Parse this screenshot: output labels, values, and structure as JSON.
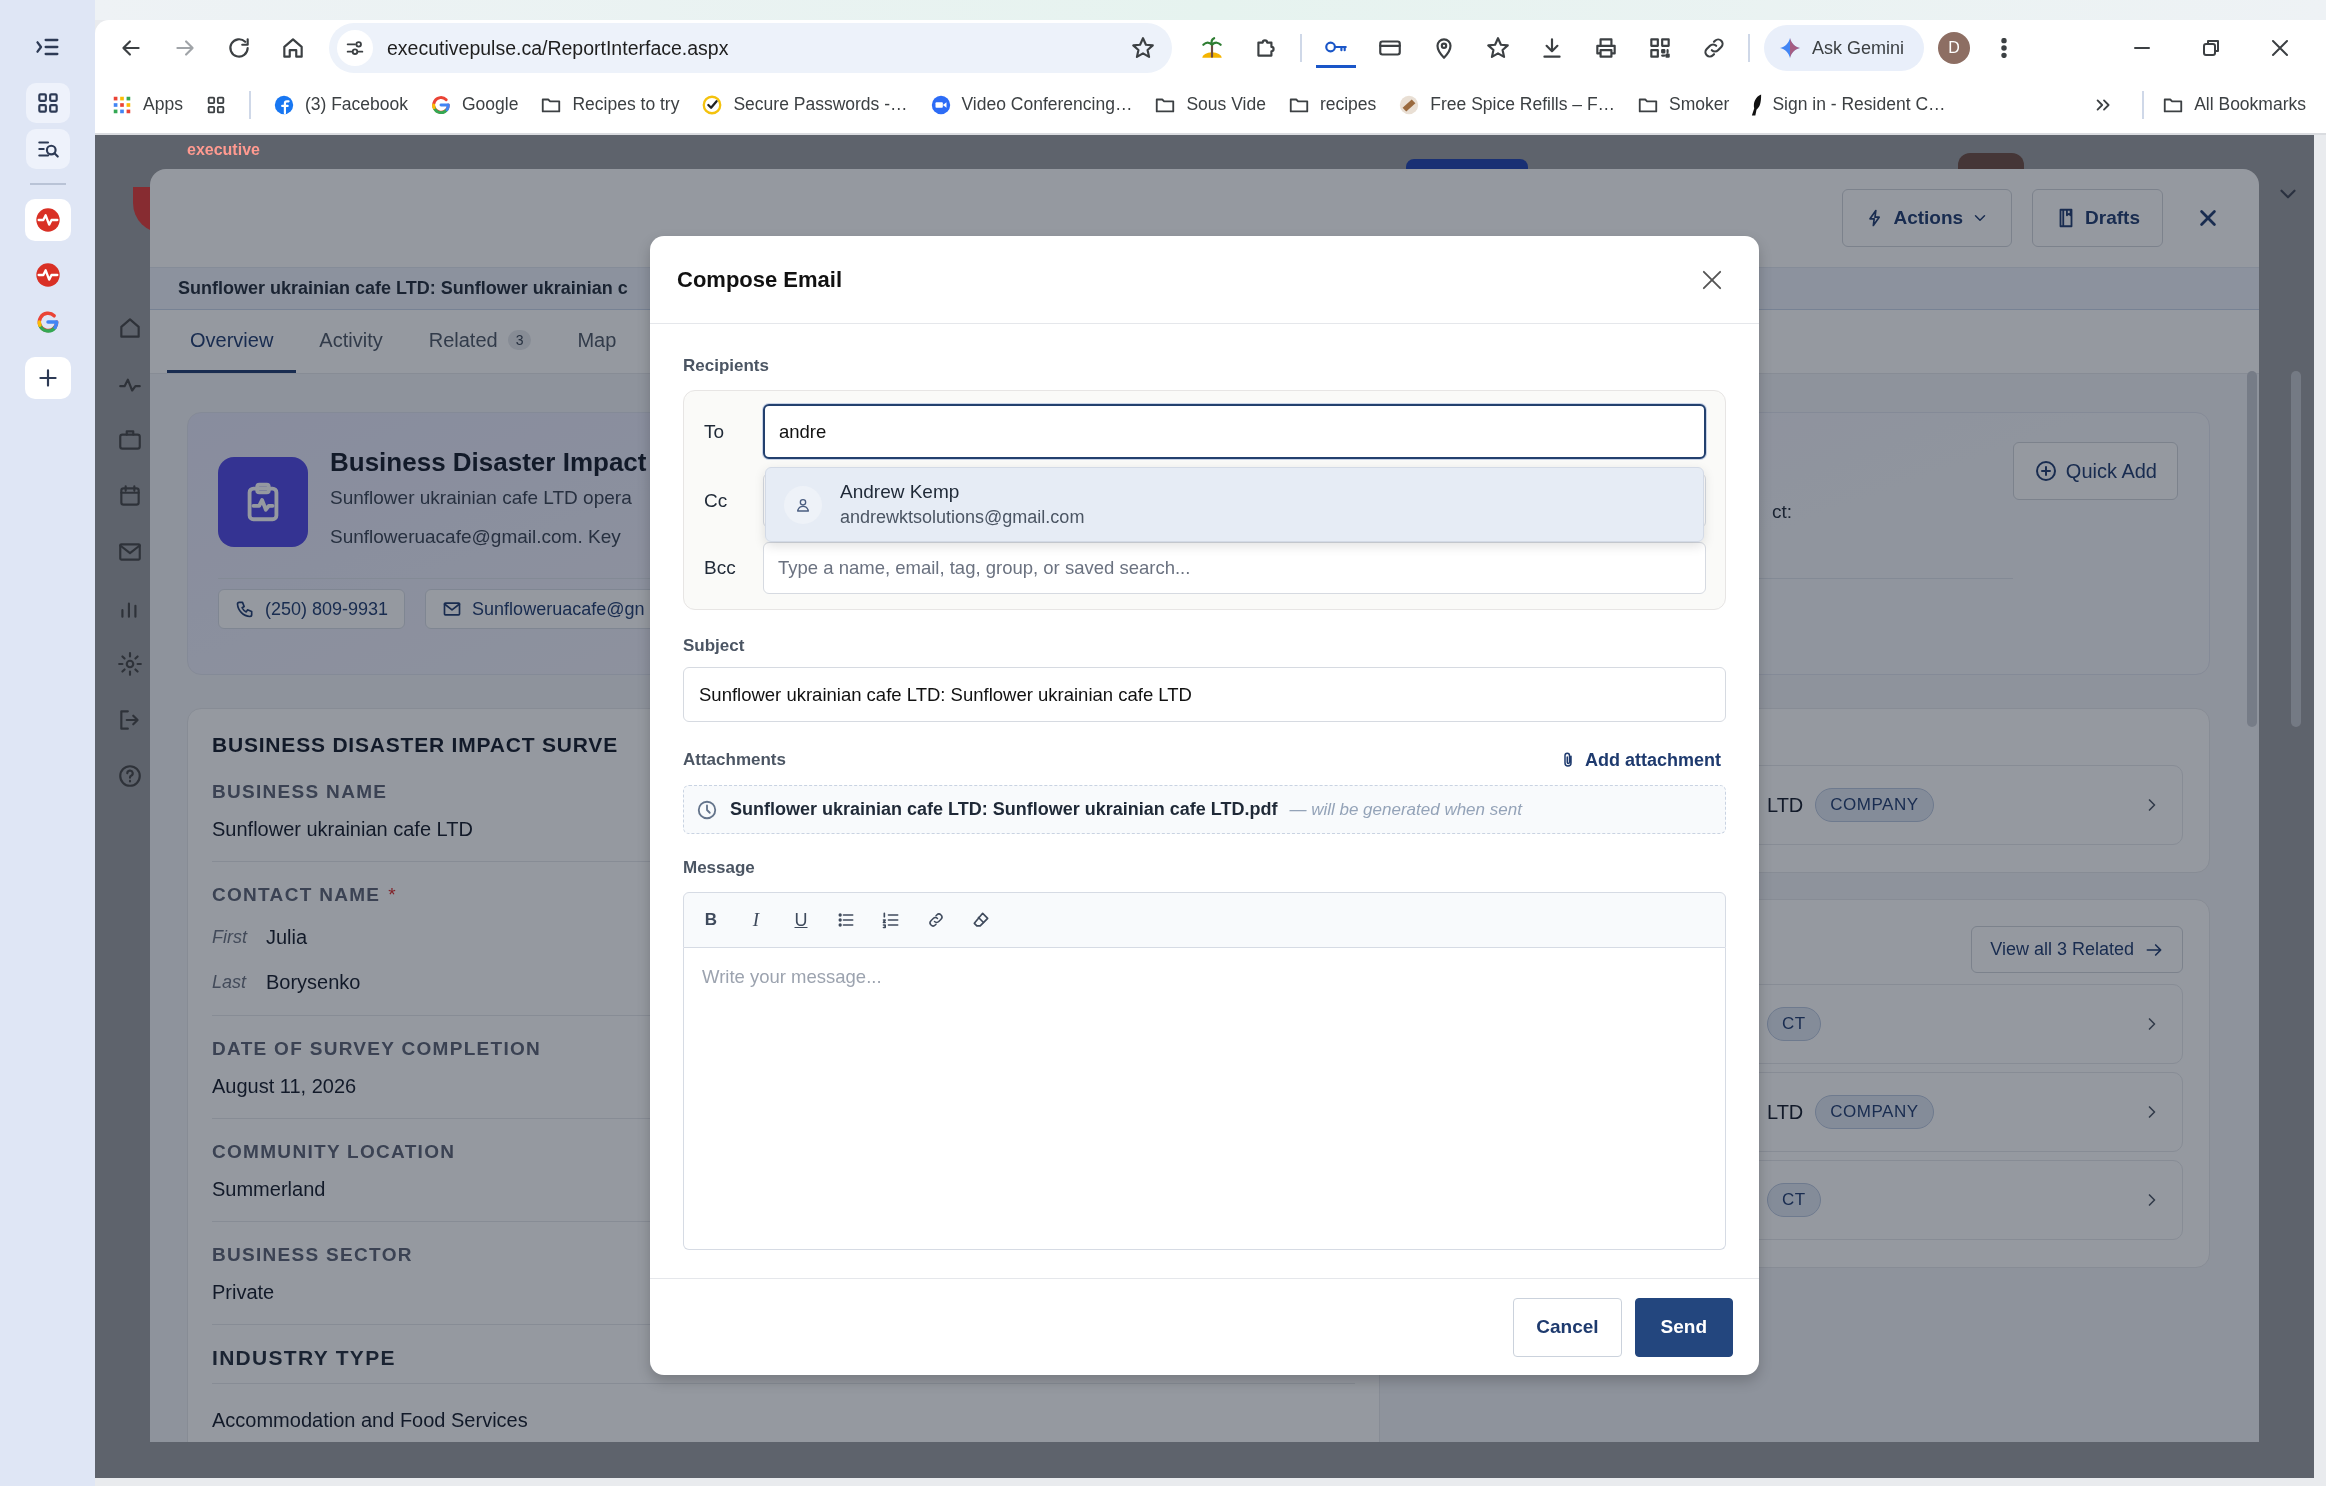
{
  "browser": {
    "url": "executivepulse.ca/ReportInterface.aspx",
    "gemini_label": "Ask Gemini",
    "profile_initial": "D",
    "bookmarks": [
      {
        "kind": "apps",
        "label": "Apps"
      },
      {
        "kind": "grid"
      },
      {
        "kind": "facebook",
        "label": "(3) Facebook"
      },
      {
        "kind": "google",
        "label": "Google"
      },
      {
        "kind": "folder",
        "label": "Recipes to try"
      },
      {
        "kind": "check",
        "label": "Secure Passwords -…"
      },
      {
        "kind": "zoom",
        "label": "Video Conferencing…"
      },
      {
        "kind": "folder",
        "label": "Sous Vide"
      },
      {
        "kind": "folder",
        "label": "recipes"
      },
      {
        "kind": "spice",
        "label": "Free Spice Refills – F…"
      },
      {
        "kind": "folder",
        "label": "Smoker"
      },
      {
        "kind": "resident",
        "label": "Sign in - Resident C…"
      }
    ],
    "all_bookmarks": "All Bookmarks"
  },
  "app": {
    "logo": "executive"
  },
  "record": {
    "actions_label": "Actions",
    "drafts_label": "Drafts",
    "subtitle": "Sunflower ukrainian cafe LTD: Sunflower ukrainian c",
    "tabs": [
      {
        "label": "Overview",
        "selected": true
      },
      {
        "label": "Activity",
        "selected": false
      },
      {
        "label": "Related",
        "count": "3",
        "selected": false
      },
      {
        "label": "Map",
        "selected": false
      }
    ],
    "summary": {
      "title": "Business Disaster Impact",
      "description_lines": [
        "Sunflower ukrainian cafe LTD opera",
        "Sunfloweruacafe@gmail.com. Key"
      ],
      "side_text": "ct:",
      "quick_add": "Quick Add",
      "chips": [
        {
          "kind": "phone",
          "text": "(250) 809-9931"
        },
        {
          "kind": "email",
          "text": "Sunfloweruacafe@gn"
        }
      ]
    },
    "survey": {
      "heading": "BUSINESS DISASTER IMPACT SURVE",
      "fields": [
        {
          "kind": "text",
          "label": "BUSINESS NAME",
          "value": "Sunflower ukrainian cafe LTD"
        },
        {
          "kind": "name",
          "label": "CONTACT NAME",
          "required_mark": "*",
          "parts": [
            {
              "label": "First",
              "value": "Julia"
            },
            {
              "label": "Last",
              "value": "Borysenko"
            }
          ]
        },
        {
          "kind": "text",
          "label": "DATE OF SURVEY COMPLETION",
          "value": "August 11, 2026"
        },
        {
          "kind": "text",
          "label": "COMMUNITY LOCATION",
          "value": "Summerland"
        },
        {
          "kind": "text",
          "label": "BUSINESS SECTOR",
          "value": "Private"
        },
        {
          "kind": "section",
          "label": "INDUSTRY TYPE",
          "value": "Accommodation and Food Services"
        }
      ]
    },
    "related_cards": [
      {
        "rows": [
          {
            "text": "LTD",
            "badge": "COMPANY"
          }
        ]
      },
      {
        "view_all": "View all 3 Related",
        "rows": [
          {
            "badge": "CT"
          },
          {
            "text": "LTD",
            "badge": "COMPANY"
          },
          {
            "badge": "CT"
          }
        ]
      }
    ]
  },
  "compose": {
    "title": "Compose Email",
    "recipients_label": "Recipients",
    "to": {
      "label": "To",
      "value": "andre"
    },
    "cc": {
      "label": "Cc"
    },
    "bcc": {
      "label": "Bcc",
      "placeholder": "Type a name, email, tag, group, or saved search..."
    },
    "suggestions": [
      {
        "name": "Andrew Kemp",
        "email": "andrewktsolutions@gmail.com",
        "selected": true
      }
    ],
    "subject": {
      "label": "Subject",
      "value": "Sunflower ukrainian cafe LTD: Sunflower ukrainian cafe LTD"
    },
    "attachments": {
      "label": "Attachments",
      "add_label": "Add attachment",
      "items": [
        {
          "name": "Sunflower ukrainian cafe LTD: Sunflower ukrainian cafe LTD.pdf",
          "note": "— will be generated when sent"
        }
      ]
    },
    "message": {
      "label": "Message",
      "placeholder": "Write your message...",
      "tools": [
        {
          "kind": "bold",
          "glyph": "B"
        },
        {
          "kind": "italic",
          "glyph": "I"
        },
        {
          "kind": "underline",
          "glyph": "U"
        },
        {
          "kind": "bullets"
        },
        {
          "kind": "numbers"
        },
        {
          "kind": "link"
        },
        {
          "kind": "eraser"
        }
      ]
    },
    "buttons": [
      {
        "label": "Cancel",
        "kind": "secondary"
      },
      {
        "label": "Send",
        "kind": "primary"
      }
    ]
  }
}
